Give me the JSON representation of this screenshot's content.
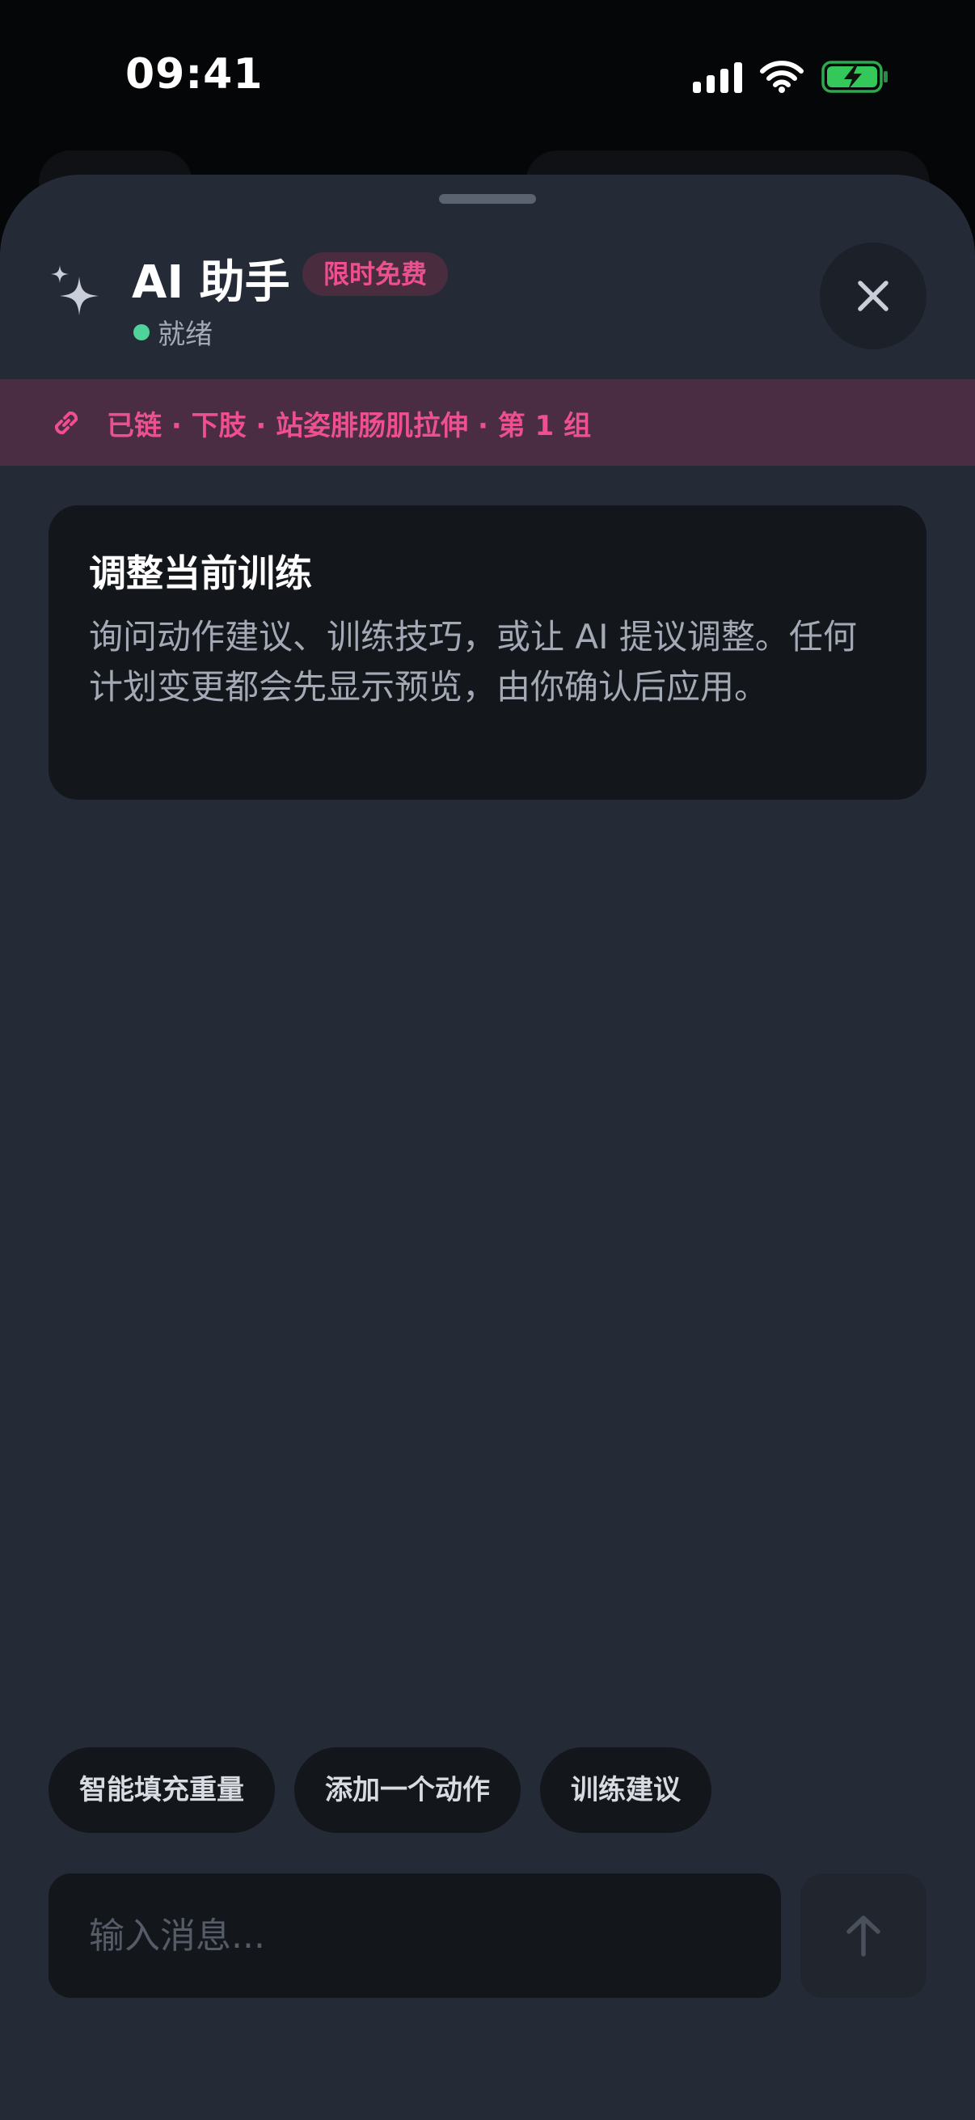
{
  "status_bar": {
    "time": "09:41",
    "icons": [
      "cellular-signal-icon",
      "wifi-icon",
      "battery-charging-icon"
    ],
    "battery_color": "#34c759"
  },
  "assistant": {
    "sparkle_icon": "sparkle-icon",
    "title": "AI 助手",
    "badge": "限时免费",
    "status": "就绪",
    "status_color": "#4fd39a",
    "close_icon": "close-icon"
  },
  "link_strip": {
    "icon": "link-icon",
    "text": "已链 · 下肢 · 站姿腓肠肌拉伸 · 第 1 组"
  },
  "intro": {
    "title": "调整当前训练",
    "body": "询问动作建议、训练技巧，或让 AI 提议调整。任何计划变更都会先显示预览，由你确认后应用。"
  },
  "chips": [
    "智能填充重量",
    "添加一个动作",
    "训练建议"
  ],
  "composer": {
    "placeholder": "输入消息...",
    "send_icon": "arrow-up-icon"
  },
  "colors": {
    "accent": "#ee4f8f",
    "sheet_background": "#252b36",
    "card_background": "#13161b"
  }
}
